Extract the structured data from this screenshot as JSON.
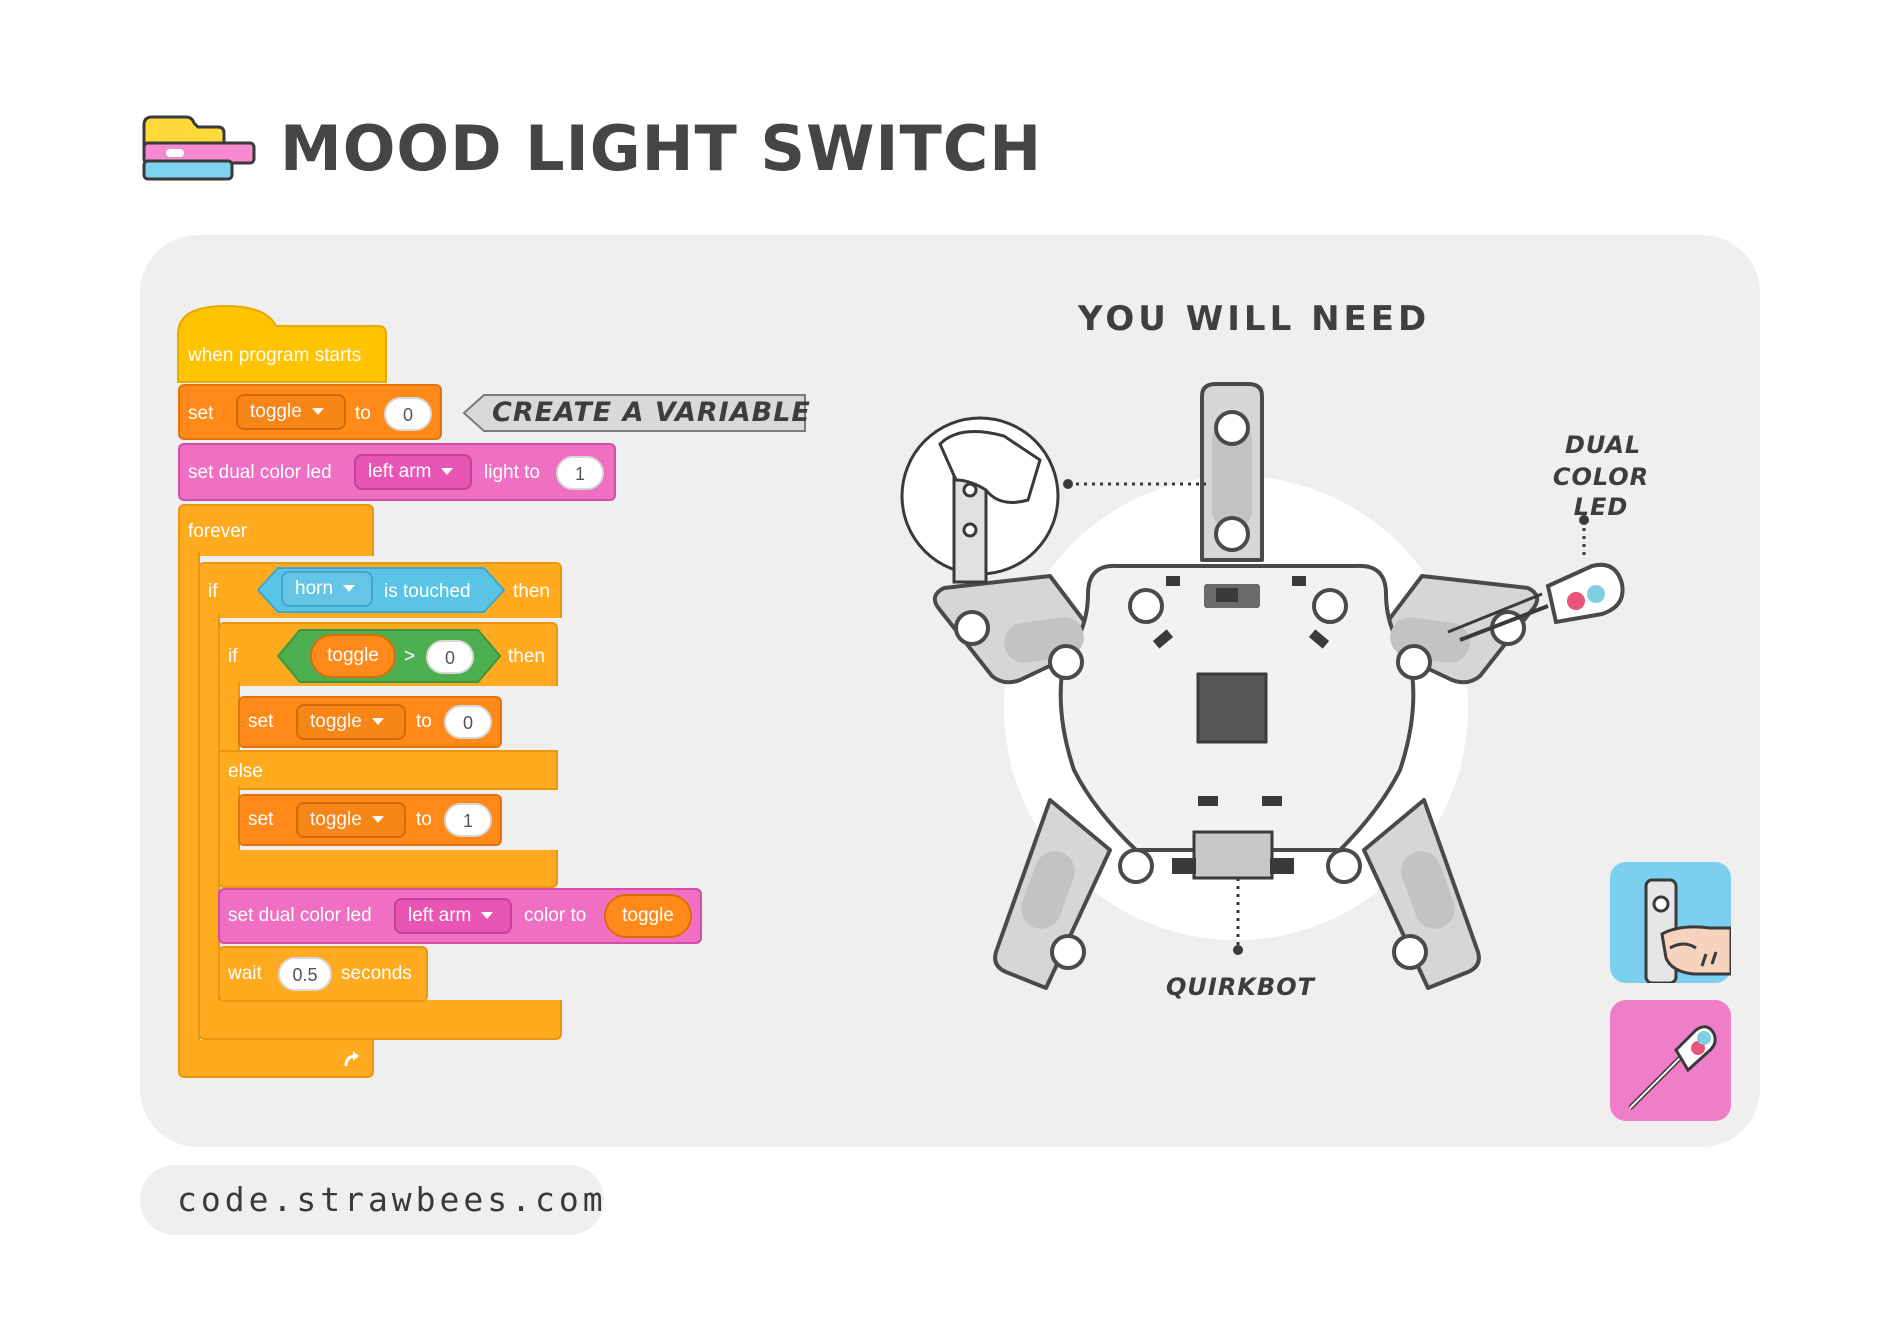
{
  "header": {
    "title": "MOOD LIGHT SWITCH",
    "logo_icon": "block-stack-icon"
  },
  "code": {
    "hat_label": "when program starts",
    "set1": {
      "set": "set",
      "var": "toggle",
      "to": "to",
      "value": "0"
    },
    "annotation": "CREATE A VARIABLE",
    "led1": {
      "label": "set dual color led",
      "target": "left arm",
      "suffix": "light to",
      "value": "1"
    },
    "forever": "forever",
    "if1": {
      "if": "if",
      "sensor": "horn",
      "condition": "is touched",
      "then": "then"
    },
    "if2": {
      "if": "if",
      "var": "toggle",
      "op": ">",
      "value": "0",
      "then": "then"
    },
    "set2": {
      "set": "set",
      "var": "toggle",
      "to": "to",
      "value": "0"
    },
    "else": "else",
    "set3": {
      "set": "set",
      "var": "toggle",
      "to": "to",
      "value": "1"
    },
    "led2": {
      "label": "set dual color led",
      "target": "left arm",
      "suffix": "color to",
      "value": "toggle"
    },
    "wait": {
      "label": "wait",
      "value": "0.5",
      "suffix": "seconds"
    }
  },
  "need": {
    "title": "YOU WILL NEED",
    "dual_led_line1": "DUAL",
    "dual_led_line2": "COLOR LED",
    "quirkbot": "QUIRKBOT",
    "badges": [
      "touch-sensor-badge-icon",
      "dual-color-led-badge-icon"
    ]
  },
  "footer": {
    "url": "code.strawbees.com"
  },
  "colors": {
    "event": "#ffc300",
    "variable": "#ff8a1a",
    "output": "#ef6fc2",
    "control": "#ffaa1f",
    "sensor": "#5bc3e6",
    "operator": "#4caf50",
    "panel": "#efefef"
  }
}
